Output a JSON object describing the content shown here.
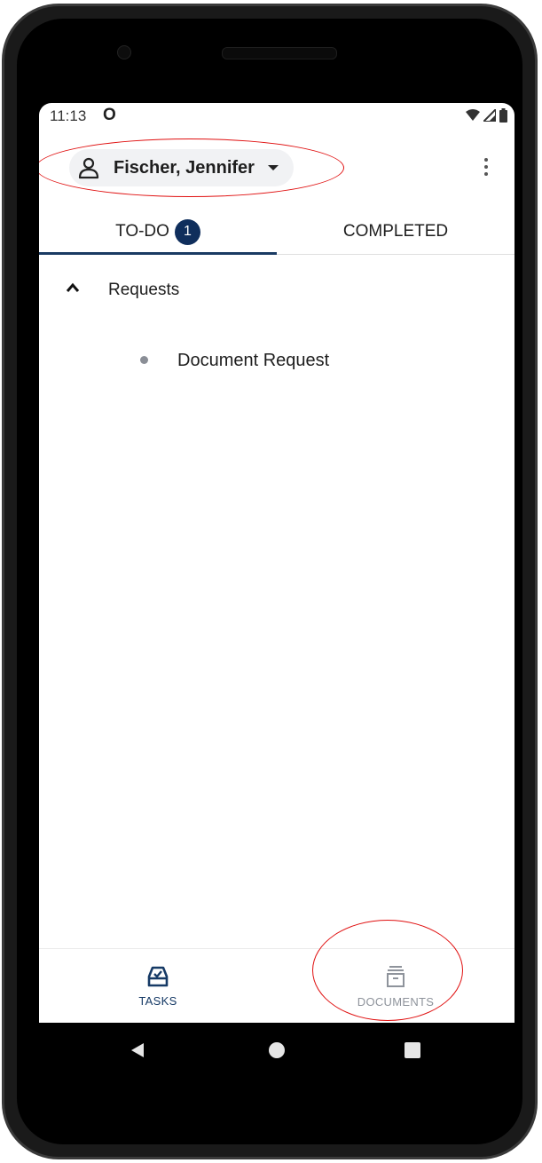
{
  "status_bar": {
    "time": "11:13",
    "indicator": "O",
    "icons": [
      "wifi-icon",
      "signal-icon",
      "battery-icon"
    ]
  },
  "header": {
    "account_icon": "person-icon",
    "account_name": "Fischer, Jennifer",
    "dropdown_icon": "caret-down-icon",
    "menu_icon": "more-vert-icon"
  },
  "tabs": [
    {
      "label": "TO-DO",
      "badge": "1",
      "active": true
    },
    {
      "label": "COMPLETED",
      "active": false
    }
  ],
  "sections": [
    {
      "title": "Requests",
      "expanded": true,
      "items": [
        {
          "label": "Document Request"
        }
      ]
    }
  ],
  "bottom_nav": [
    {
      "label": "TASKS",
      "icon": "inbox-check-icon",
      "active": true
    },
    {
      "label": "DOCUMENTS",
      "icon": "archive-box-icon",
      "active": false
    }
  ],
  "colors": {
    "primary": "#0f2e5c",
    "annotation": "#e01010",
    "inactive": "#8e939b"
  }
}
